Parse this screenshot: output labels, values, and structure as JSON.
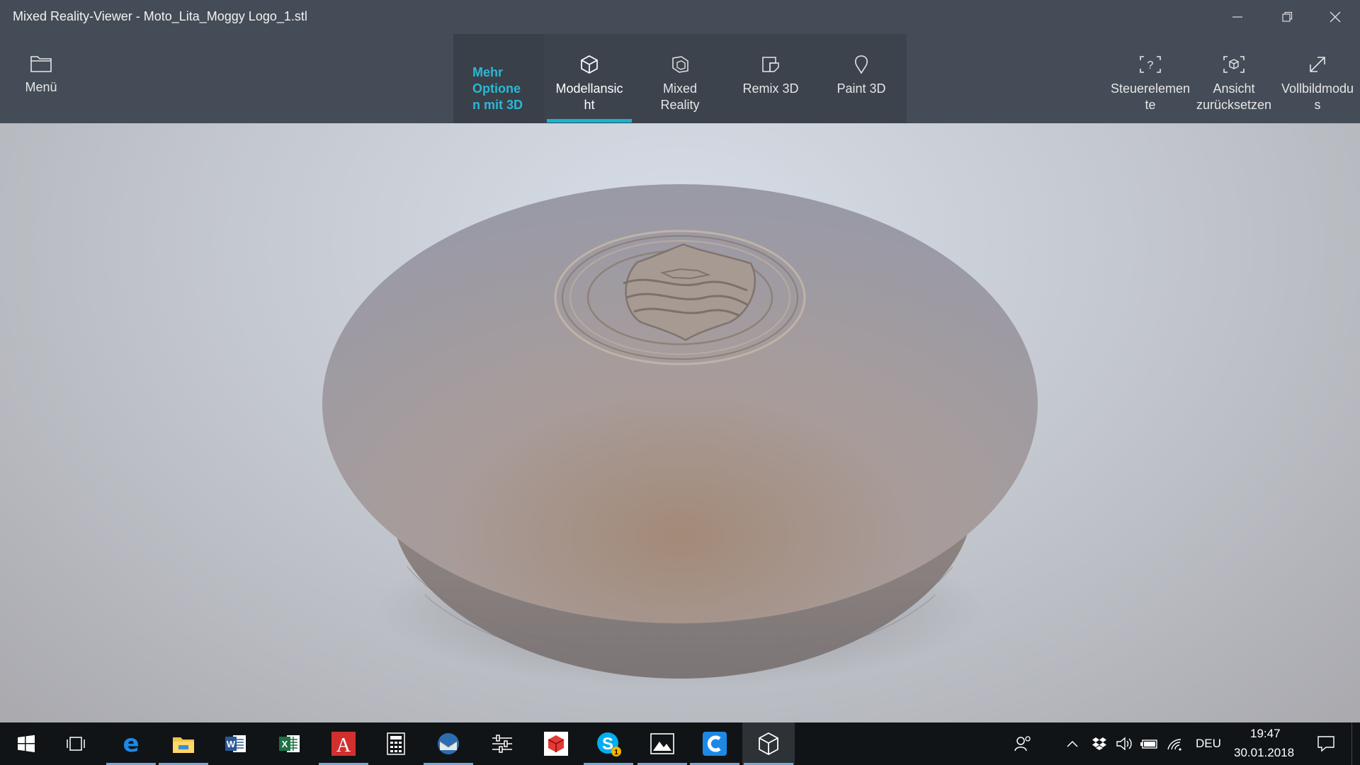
{
  "window": {
    "title": "Mixed Reality-Viewer - Moto_Lita_Moggy Logo_1.stl",
    "controls": [
      "minimize-icon",
      "restore-icon",
      "close-icon"
    ]
  },
  "toolbar": {
    "menu_label": "Menü",
    "more_options_label": "Mehr\nOptione\nn mit 3D",
    "tabs": [
      {
        "label": "Modellansic\nht",
        "icon": "cube-icon",
        "selected": true
      },
      {
        "label": "Mixed\nReality",
        "icon": "mixed-reality-icon",
        "selected": false
      },
      {
        "label": "Remix 3D",
        "icon": "remix3d-icon",
        "selected": false
      },
      {
        "label": "Paint 3D",
        "icon": "paint3d-icon",
        "selected": false
      }
    ],
    "right_buttons": [
      {
        "label": "Steuerelemen\nte",
        "icon": "controls-help-icon"
      },
      {
        "label": "Ansicht\nzurücksetzen",
        "icon": "reset-view-icon"
      },
      {
        "label": "Vollbildmodu\ns",
        "icon": "fullscreen-icon"
      }
    ],
    "accent_color": "#19b3d3"
  },
  "viewport": {
    "model": "3D disc with embossed shield logo"
  },
  "taskbar": {
    "apps": [
      "start-icon",
      "task-view-icon",
      "edge-icon",
      "file-explorer-icon",
      "word-icon",
      "excel-icon",
      "acrobat-icon",
      "calculator-icon",
      "thunderbird-icon",
      "settings-sliders-icon",
      "3d-builder-icon",
      "skype-icon",
      "photos-icon",
      "cura-icon",
      "mixed-reality-viewer-icon"
    ],
    "skype_badge": "1",
    "tray": {
      "language": "DEU",
      "time": "19:47",
      "date": "30.01.2018"
    }
  }
}
